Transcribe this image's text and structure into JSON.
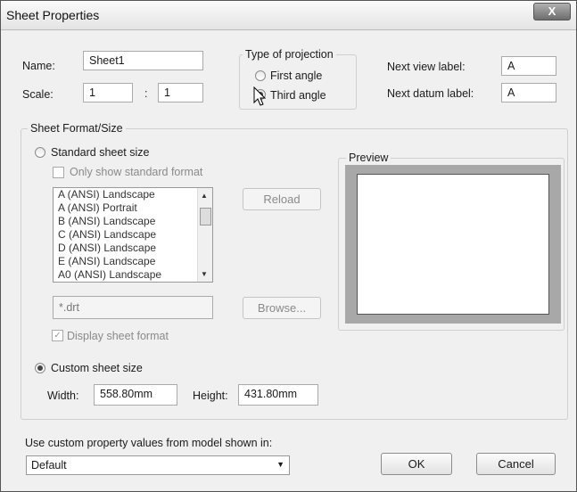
{
  "window": {
    "title": "Sheet Properties",
    "close_glyph": "X"
  },
  "sheet": {
    "name_label": "Name:",
    "name_value": "Sheet1",
    "scale_label": "Scale:",
    "scale_num": "1",
    "scale_sep": ":",
    "scale_den": "1"
  },
  "projection": {
    "legend": "Type of projection",
    "first_angle": "First angle",
    "third_angle": "Third angle",
    "selected": "third"
  },
  "labels": {
    "next_view_label": "Next view label:",
    "next_view_value": "A",
    "next_datum_label": "Next datum label:",
    "next_datum_value": "A"
  },
  "format": {
    "legend": "Sheet Format/Size",
    "standard_label": "Standard sheet size",
    "only_standard_label": "Only show standard format",
    "list_items": [
      "A (ANSI) Landscape",
      "A (ANSI) Portrait",
      "B (ANSI) Landscape",
      "C (ANSI) Landscape",
      "D (ANSI) Landscape",
      "E (ANSI) Landscape",
      "A0 (ANSI) Landscape"
    ],
    "reload_label": "Reload",
    "file_value": "*.drt",
    "browse_label": "Browse...",
    "display_format_label": "Display sheet format",
    "custom_label": "Custom sheet size",
    "width_label": "Width:",
    "width_value": "558.80mm",
    "height_label": "Height:",
    "height_value": "431.80mm",
    "selected": "custom"
  },
  "preview": {
    "legend": "Preview"
  },
  "footer": {
    "custom_property_label": "Use custom property values from model shown in:",
    "model_value": "Default",
    "ok_label": "OK",
    "cancel_label": "Cancel"
  }
}
